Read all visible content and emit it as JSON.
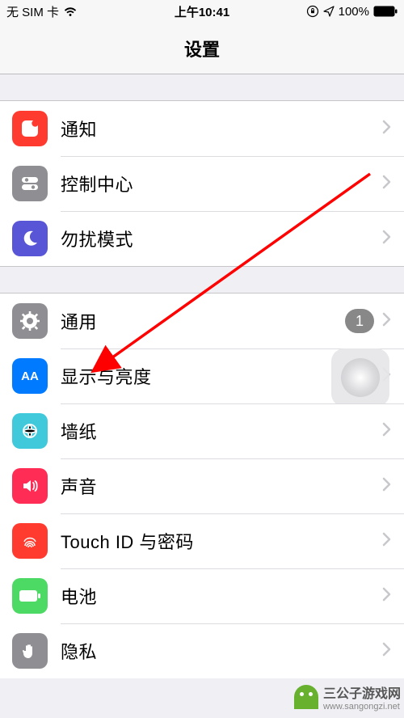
{
  "status_bar": {
    "carrier": "无 SIM 卡",
    "time": "上午10:41",
    "battery_pct": "100%"
  },
  "header": {
    "title": "设置"
  },
  "group1": {
    "notifications": {
      "label": "通知"
    },
    "control_center": {
      "label": "控制中心"
    },
    "do_not_disturb": {
      "label": "勿扰模式"
    }
  },
  "group2": {
    "general": {
      "label": "通用",
      "badge": "1"
    },
    "display": {
      "label": "显示与亮度"
    },
    "wallpaper": {
      "label": "墙纸"
    },
    "sound": {
      "label": "声音"
    },
    "touchid": {
      "label": "Touch ID 与密码"
    },
    "battery": {
      "label": "电池"
    },
    "privacy": {
      "label": "隐私"
    }
  },
  "watermark": {
    "text": "三公子游戏网",
    "url": "www.sangongzi.net"
  }
}
